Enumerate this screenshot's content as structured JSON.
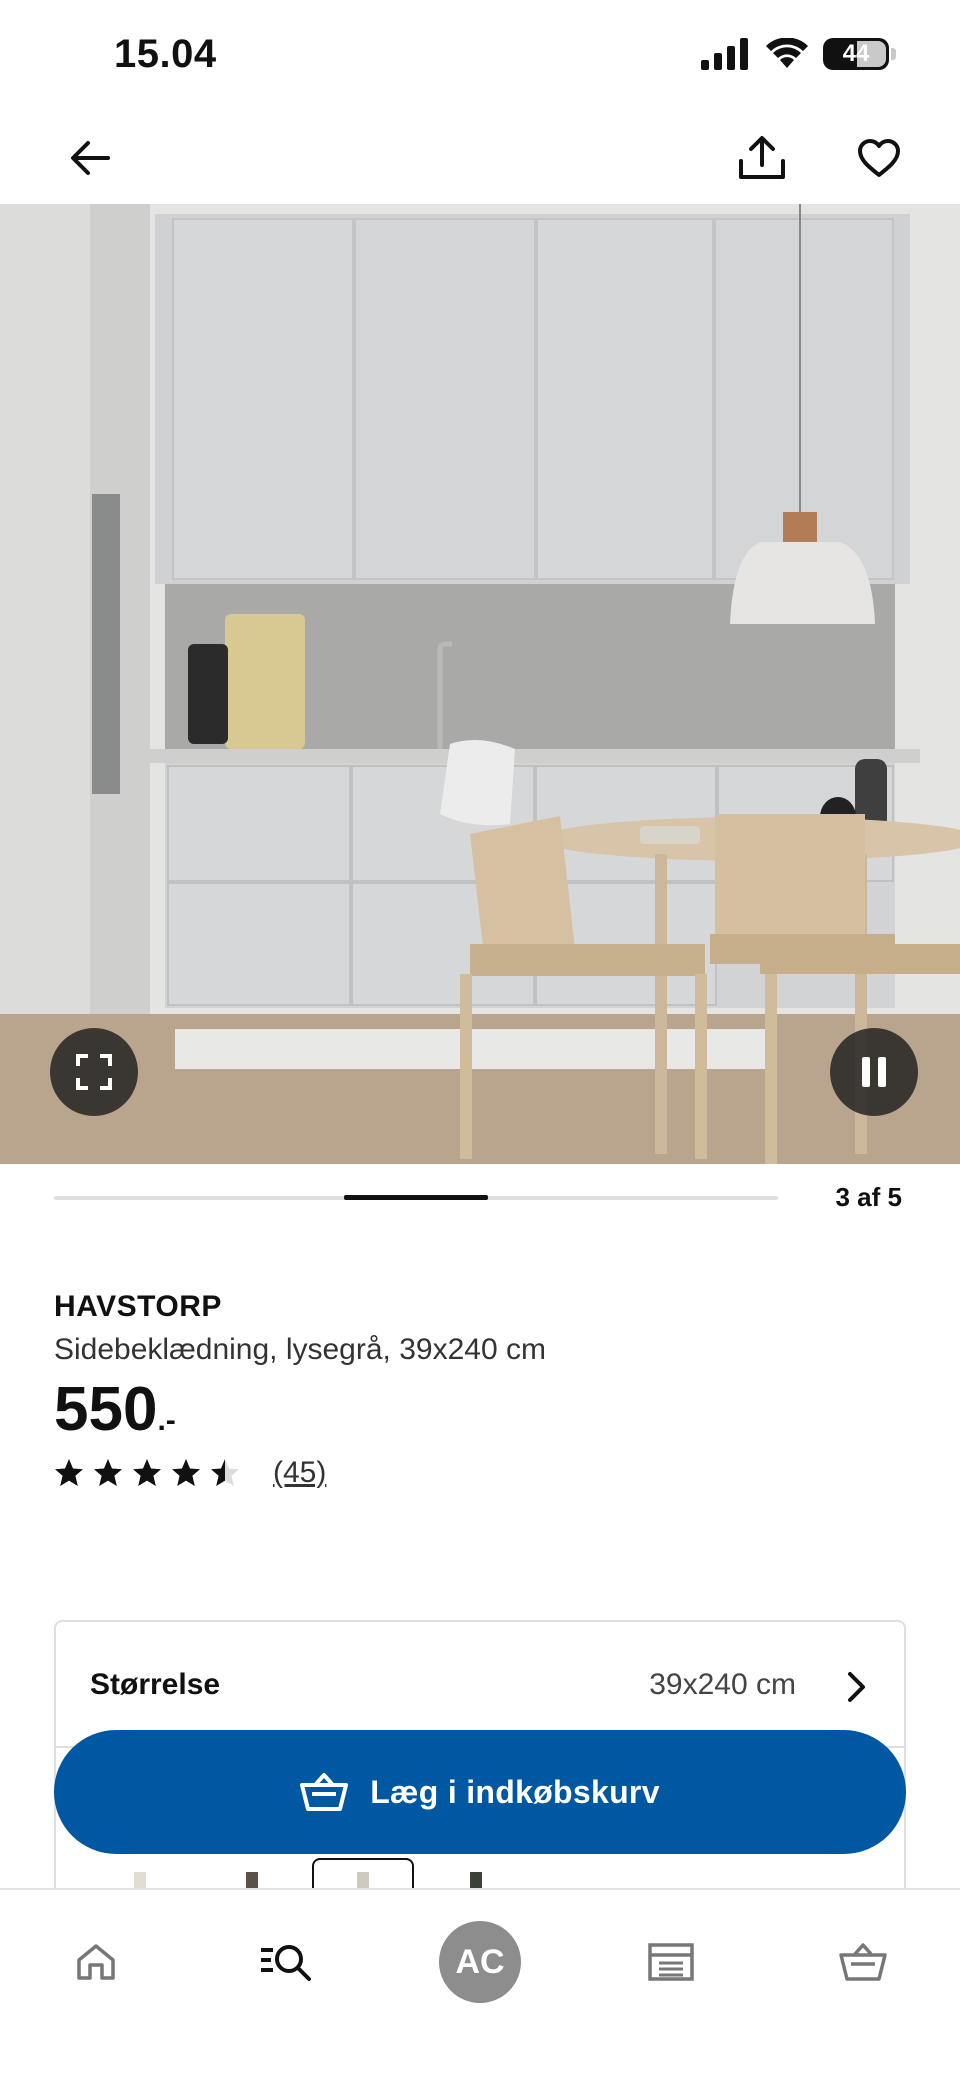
{
  "status_bar": {
    "time": "15.04",
    "battery": "44"
  },
  "gallery": {
    "counter": "3 af 5",
    "current_index": 3,
    "total": 5
  },
  "product": {
    "name": "HAVSTORP",
    "description": "Sidebeklædning, lysegrå, 39x240 cm",
    "price": "550",
    "price_suffix": ".-",
    "rating": 4.5,
    "review_count": "(45)"
  },
  "options": {
    "size_label": "Størrelse",
    "size_value": "39x240 cm"
  },
  "cta": {
    "label": "Læg i indkøbskurv"
  },
  "bottom_nav": {
    "avatar_initials": "AC"
  },
  "colors": {
    "brand_blue": "#0058a3",
    "text": "#111111",
    "divider": "#dfdfdf"
  }
}
